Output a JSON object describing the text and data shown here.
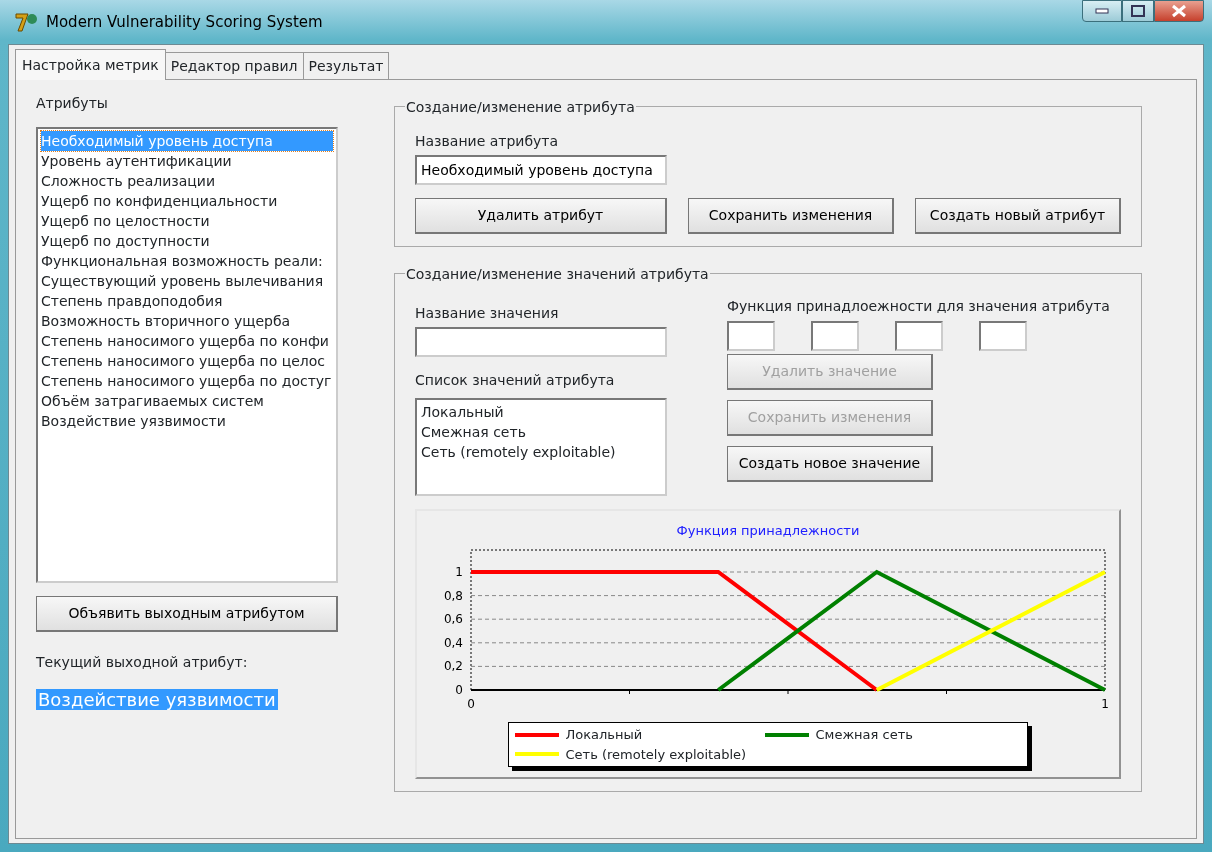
{
  "window": {
    "title": "Modern Vulnerability Scoring System"
  },
  "tabs": [
    {
      "label": "Настройка метрик",
      "selected": true
    },
    {
      "label": "Редактор правил",
      "selected": false
    },
    {
      "label": "Результат",
      "selected": false
    }
  ],
  "attributes": {
    "label": "Атрибуты",
    "items": [
      {
        "text": "Необходимый уровень доступа",
        "selected": true
      },
      {
        "text": "Уровень аутентификации",
        "selected": false
      },
      {
        "text": "Сложность реализации",
        "selected": false
      },
      {
        "text": "Ущерб по конфиденциальности",
        "selected": false
      },
      {
        "text": "Ущерб по целостности",
        "selected": false
      },
      {
        "text": "Ущерб по доступности",
        "selected": false
      },
      {
        "text": "Функциональная возможность реали:",
        "selected": false
      },
      {
        "text": "Существующий уровень вылечивания",
        "selected": false
      },
      {
        "text": "Степень правдоподобия",
        "selected": false
      },
      {
        "text": "Возможность вторичного ущерба",
        "selected": false
      },
      {
        "text": "Степень наносимого ущерба по конфи",
        "selected": false
      },
      {
        "text": "Степень наносимого ущерба по целос",
        "selected": false
      },
      {
        "text": "Степень наносимого ущерба по достуг",
        "selected": false
      },
      {
        "text": "Объём затрагиваемых систем",
        "selected": false
      },
      {
        "text": "Воздействие уязвимости",
        "selected": false
      }
    ],
    "output_button": "Объявить выходным атрибутом",
    "current_output_label": "Текущий выходной атрибут:",
    "current_output": "Воздействие уязвимости"
  },
  "attribute_group": {
    "title": "Создание/изменение атрибута",
    "name_label": "Название атрибута",
    "name_value": "Необходимый уровень доступа",
    "buttons": [
      {
        "label": "Удалить атрибут",
        "disabled": false
      },
      {
        "label": "Сохранить изменения",
        "disabled": false
      },
      {
        "label": "Создать новый атрибут",
        "disabled": false
      }
    ]
  },
  "value_group": {
    "title": "Создание/изменение значений атрибута",
    "name_label": "Название значения",
    "function_label": "Функция принадлоежности для значения атрибута",
    "list_label": "Список значений атрибута",
    "values": [
      {
        "text": "Локальный",
        "selected": false
      },
      {
        "text": "Смежная сеть",
        "selected": false
      },
      {
        "text": "Сеть (remotely exploitable)",
        "selected": false
      }
    ],
    "buttons": [
      {
        "label": "Удалить значение",
        "disabled": true
      },
      {
        "label": "Сохранить изменения",
        "disabled": true
      },
      {
        "label": "Создать новое значение",
        "disabled": false
      }
    ],
    "chart_data": {
      "type": "line",
      "title": "Функция принадлежности",
      "grid": true,
      "legend": true,
      "x": [
        0,
        0.39,
        0.64,
        1
      ],
      "xlim": [
        0,
        1
      ],
      "ylim": [
        0,
        1
      ],
      "xticks": [
        0,
        1
      ],
      "yticks": [
        {
          "value": 0,
          "label": "0"
        },
        {
          "value": 0.2,
          "label": "0,2"
        },
        {
          "value": 0.4,
          "label": "0,4"
        },
        {
          "value": 0.6,
          "label": "0,6"
        },
        {
          "value": 0.8,
          "label": "0,8"
        },
        {
          "value": 1,
          "label": "1"
        }
      ],
      "series": [
        {
          "name": "Локальный",
          "color": "#ff0000",
          "values": [
            1,
            1,
            0,
            null
          ]
        },
        {
          "name": "Смежная сеть",
          "color": "#008000",
          "values": [
            null,
            0,
            1,
            0
          ]
        },
        {
          "name": "Сеть (remotely exploitable)",
          "color": "#ffff00",
          "values": [
            null,
            null,
            0,
            1
          ]
        }
      ]
    }
  }
}
